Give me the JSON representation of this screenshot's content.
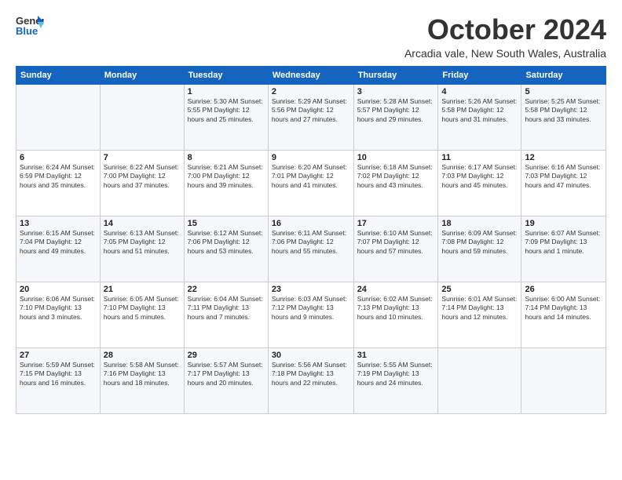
{
  "logo": {
    "line1": "General",
    "line2": "Blue"
  },
  "title": "October 2024",
  "subtitle": "Arcadia vale, New South Wales, Australia",
  "weekdays": [
    "Sunday",
    "Monday",
    "Tuesday",
    "Wednesday",
    "Thursday",
    "Friday",
    "Saturday"
  ],
  "weeks": [
    [
      {
        "day": "",
        "info": ""
      },
      {
        "day": "",
        "info": ""
      },
      {
        "day": "1",
        "info": "Sunrise: 5:30 AM\nSunset: 5:55 PM\nDaylight: 12 hours\nand 25 minutes."
      },
      {
        "day": "2",
        "info": "Sunrise: 5:29 AM\nSunset: 5:56 PM\nDaylight: 12 hours\nand 27 minutes."
      },
      {
        "day": "3",
        "info": "Sunrise: 5:28 AM\nSunset: 5:57 PM\nDaylight: 12 hours\nand 29 minutes."
      },
      {
        "day": "4",
        "info": "Sunrise: 5:26 AM\nSunset: 5:58 PM\nDaylight: 12 hours\nand 31 minutes."
      },
      {
        "day": "5",
        "info": "Sunrise: 5:25 AM\nSunset: 5:58 PM\nDaylight: 12 hours\nand 33 minutes."
      }
    ],
    [
      {
        "day": "6",
        "info": "Sunrise: 6:24 AM\nSunset: 6:59 PM\nDaylight: 12 hours\nand 35 minutes."
      },
      {
        "day": "7",
        "info": "Sunrise: 6:22 AM\nSunset: 7:00 PM\nDaylight: 12 hours\nand 37 minutes."
      },
      {
        "day": "8",
        "info": "Sunrise: 6:21 AM\nSunset: 7:00 PM\nDaylight: 12 hours\nand 39 minutes."
      },
      {
        "day": "9",
        "info": "Sunrise: 6:20 AM\nSunset: 7:01 PM\nDaylight: 12 hours\nand 41 minutes."
      },
      {
        "day": "10",
        "info": "Sunrise: 6:18 AM\nSunset: 7:02 PM\nDaylight: 12 hours\nand 43 minutes."
      },
      {
        "day": "11",
        "info": "Sunrise: 6:17 AM\nSunset: 7:03 PM\nDaylight: 12 hours\nand 45 minutes."
      },
      {
        "day": "12",
        "info": "Sunrise: 6:16 AM\nSunset: 7:03 PM\nDaylight: 12 hours\nand 47 minutes."
      }
    ],
    [
      {
        "day": "13",
        "info": "Sunrise: 6:15 AM\nSunset: 7:04 PM\nDaylight: 12 hours\nand 49 minutes."
      },
      {
        "day": "14",
        "info": "Sunrise: 6:13 AM\nSunset: 7:05 PM\nDaylight: 12 hours\nand 51 minutes."
      },
      {
        "day": "15",
        "info": "Sunrise: 6:12 AM\nSunset: 7:06 PM\nDaylight: 12 hours\nand 53 minutes."
      },
      {
        "day": "16",
        "info": "Sunrise: 6:11 AM\nSunset: 7:06 PM\nDaylight: 12 hours\nand 55 minutes."
      },
      {
        "day": "17",
        "info": "Sunrise: 6:10 AM\nSunset: 7:07 PM\nDaylight: 12 hours\nand 57 minutes."
      },
      {
        "day": "18",
        "info": "Sunrise: 6:09 AM\nSunset: 7:08 PM\nDaylight: 12 hours\nand 59 minutes."
      },
      {
        "day": "19",
        "info": "Sunrise: 6:07 AM\nSunset: 7:09 PM\nDaylight: 13 hours\nand 1 minute."
      }
    ],
    [
      {
        "day": "20",
        "info": "Sunrise: 6:06 AM\nSunset: 7:10 PM\nDaylight: 13 hours\nand 3 minutes."
      },
      {
        "day": "21",
        "info": "Sunrise: 6:05 AM\nSunset: 7:10 PM\nDaylight: 13 hours\nand 5 minutes."
      },
      {
        "day": "22",
        "info": "Sunrise: 6:04 AM\nSunset: 7:11 PM\nDaylight: 13 hours\nand 7 minutes."
      },
      {
        "day": "23",
        "info": "Sunrise: 6:03 AM\nSunset: 7:12 PM\nDaylight: 13 hours\nand 9 minutes."
      },
      {
        "day": "24",
        "info": "Sunrise: 6:02 AM\nSunset: 7:13 PM\nDaylight: 13 hours\nand 10 minutes."
      },
      {
        "day": "25",
        "info": "Sunrise: 6:01 AM\nSunset: 7:14 PM\nDaylight: 13 hours\nand 12 minutes."
      },
      {
        "day": "26",
        "info": "Sunrise: 6:00 AM\nSunset: 7:14 PM\nDaylight: 13 hours\nand 14 minutes."
      }
    ],
    [
      {
        "day": "27",
        "info": "Sunrise: 5:59 AM\nSunset: 7:15 PM\nDaylight: 13 hours\nand 16 minutes."
      },
      {
        "day": "28",
        "info": "Sunrise: 5:58 AM\nSunset: 7:16 PM\nDaylight: 13 hours\nand 18 minutes."
      },
      {
        "day": "29",
        "info": "Sunrise: 5:57 AM\nSunset: 7:17 PM\nDaylight: 13 hours\nand 20 minutes."
      },
      {
        "day": "30",
        "info": "Sunrise: 5:56 AM\nSunset: 7:18 PM\nDaylight: 13 hours\nand 22 minutes."
      },
      {
        "day": "31",
        "info": "Sunrise: 5:55 AM\nSunset: 7:19 PM\nDaylight: 13 hours\nand 24 minutes."
      },
      {
        "day": "",
        "info": ""
      },
      {
        "day": "",
        "info": ""
      }
    ]
  ]
}
